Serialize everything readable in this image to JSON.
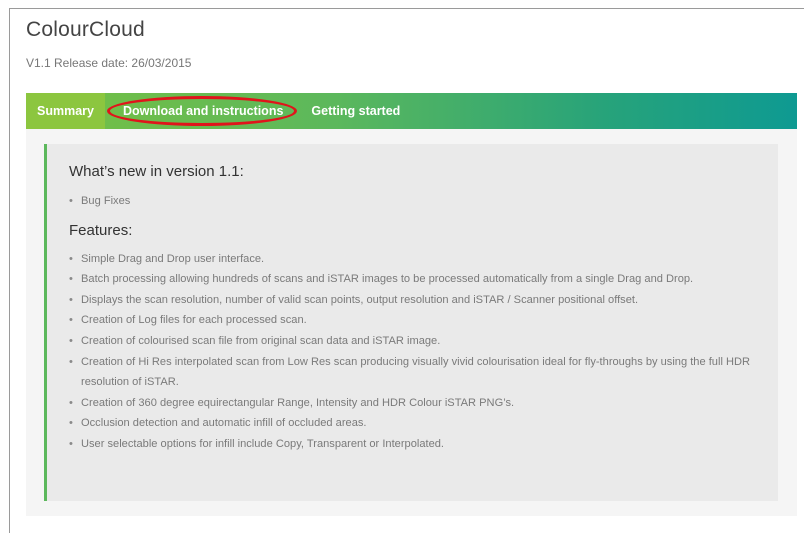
{
  "app": {
    "title": "ColourCloud",
    "release": "V1.1 Release date: 26/03/2015"
  },
  "tabs": [
    {
      "label": "Summary",
      "active": true
    },
    {
      "label": "Download and instructions",
      "annotated": true
    },
    {
      "label": "Getting started"
    }
  ],
  "content": {
    "whats_new_heading": "What’s new in version 1.1:",
    "whats_new_items": [
      "Bug Fixes"
    ],
    "features_heading": "Features:",
    "features": [
      "Simple Drag and Drop user interface.",
      "Batch processing allowing hundreds of scans and iSTAR images to be processed automatically from a single Drag and Drop.",
      "Displays the scan resolution, number of valid scan points, output resolution and iSTAR / Scanner positional offset.",
      "Creation of Log files for each processed scan.",
      "Creation of colourised scan file from original scan data and iSTAR image.",
      "Creation of Hi Res interpolated scan from Low Res scan producing visually vivid colourisation ideal for fly-throughs by using the full HDR resolution of iSTAR.",
      "Creation of 360 degree equirectangular Range, Intensity and HDR Colour iSTAR PNG’s.",
      "Occlusion detection and automatic infill of occluded areas.",
      "User selectable options for infill include Copy, Transparent or Interpolated."
    ]
  },
  "colors": {
    "tab_gradient_start": "#76c043",
    "tab_gradient_end": "#0e9a92",
    "active_tab": "#8cc63f",
    "annotation_circle": "#e0141b",
    "content_accent": "#5cb85c"
  }
}
